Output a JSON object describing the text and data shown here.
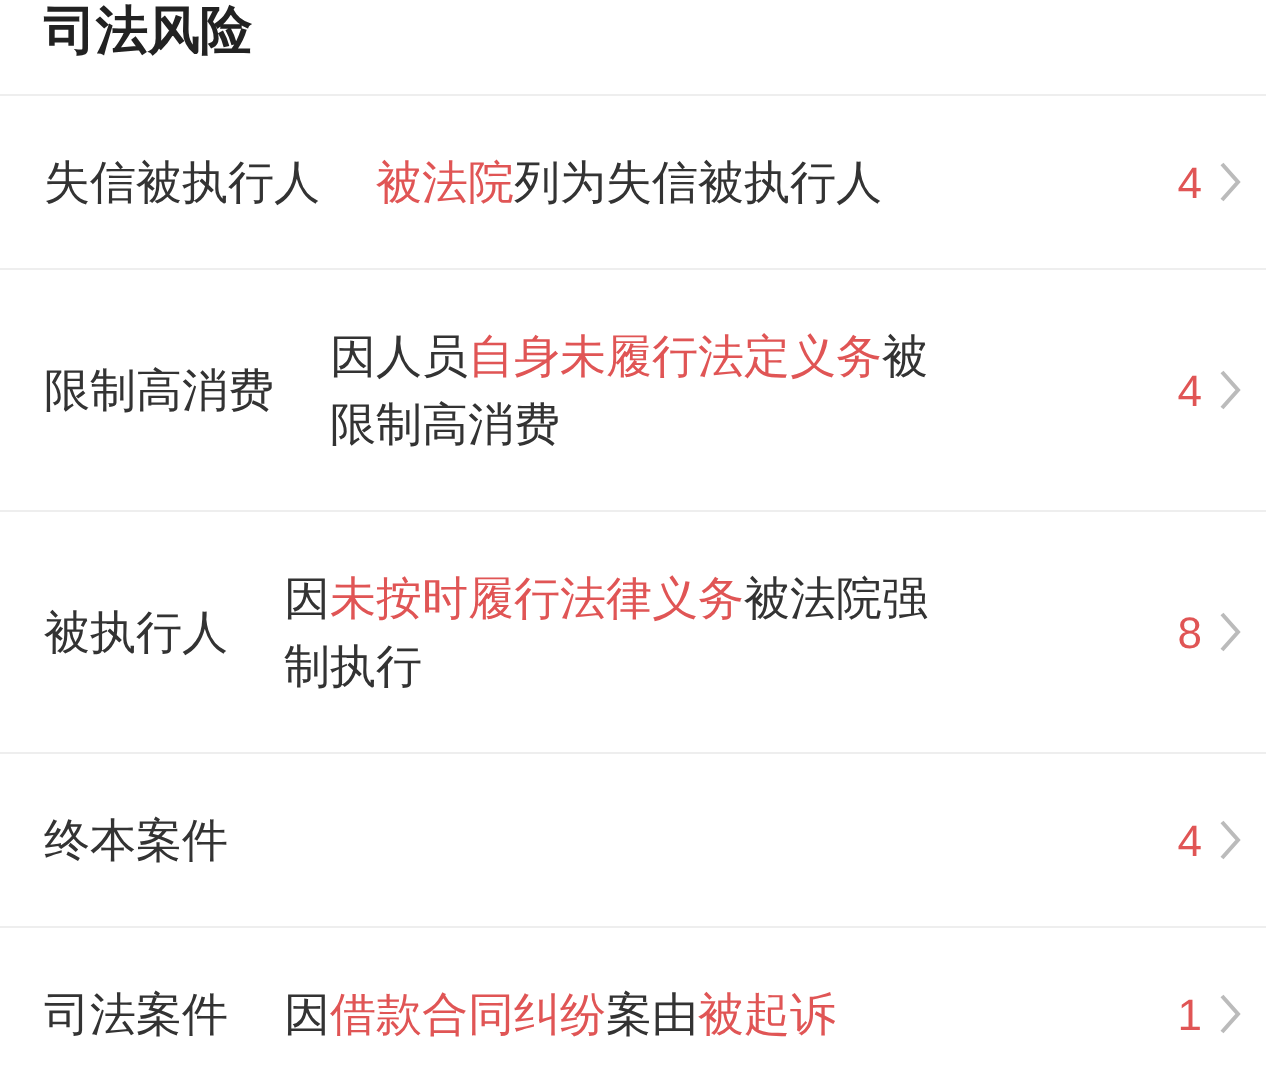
{
  "title": "司法风险",
  "items": [
    {
      "label": "失信被执行人",
      "description": [
        {
          "text": "被法院",
          "highlight": true
        },
        {
          "text": "列为失信被执行人",
          "highlight": false
        }
      ],
      "count": "4"
    },
    {
      "label": "限制高消费",
      "description": [
        {
          "text": "因人员",
          "highlight": false
        },
        {
          "text": "自身未履行法定义务",
          "highlight": true
        },
        {
          "text": "被限制高消费",
          "highlight": false
        }
      ],
      "count": "4"
    },
    {
      "label": "被执行人",
      "description": [
        {
          "text": "因",
          "highlight": false
        },
        {
          "text": "未按时履行法律义务",
          "highlight": true
        },
        {
          "text": "被法院强制执行",
          "highlight": false
        }
      ],
      "count": "8"
    },
    {
      "label": "终本案件",
      "count": "4"
    },
    {
      "label": "司法案件",
      "description": [
        {
          "text": "因",
          "highlight": false
        },
        {
          "text": "借款合同纠纷",
          "highlight": true
        },
        {
          "text": "案由",
          "highlight": false
        },
        {
          "text": "被起诉",
          "highlight": true
        }
      ],
      "count": "1"
    }
  ]
}
